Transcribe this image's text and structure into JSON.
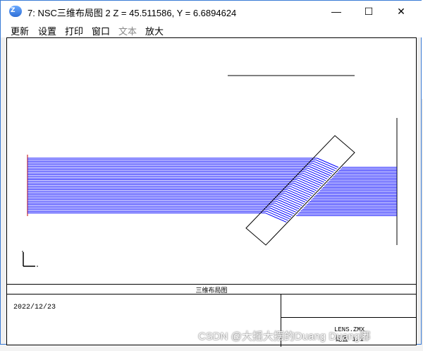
{
  "window": {
    "title": "7: NSC三维布局图 2 Z = 45.511586, Y = 6.6894624",
    "icon": "zemax-app-icon",
    "controls": {
      "minimize": "—",
      "maximize": "☐",
      "close": "✕"
    }
  },
  "menu": [
    {
      "label": "更新",
      "enabled": true
    },
    {
      "label": "设置",
      "enabled": true
    },
    {
      "label": "打印",
      "enabled": true
    },
    {
      "label": "窗口",
      "enabled": true
    },
    {
      "label": "文本",
      "enabled": false
    },
    {
      "label": "放大",
      "enabled": true
    }
  ],
  "plot": {
    "title": "三维布局图",
    "date": "2022/12/23",
    "file": "LENS.ZMX",
    "config": "配置 1/1",
    "ray_color": "#0000ff"
  },
  "watermark": "CSDN @大摇大摆的Duang Duang嘟"
}
